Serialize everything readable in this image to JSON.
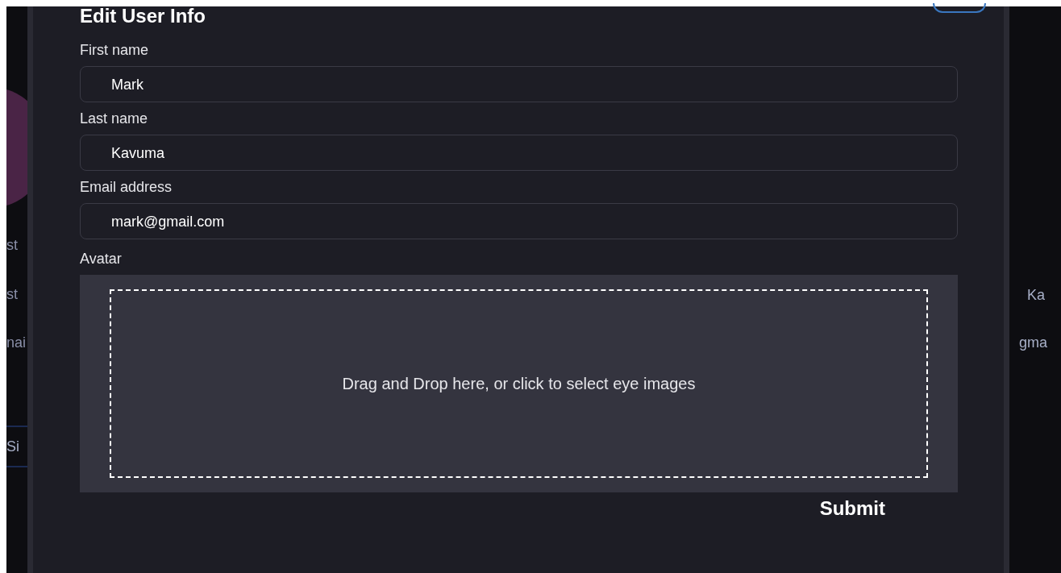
{
  "background": {
    "left_texts": [
      "st",
      "st",
      "nai",
      "Si"
    ],
    "right_texts": [
      "Ka",
      "gma"
    ]
  },
  "dialog": {
    "title": "Edit User Info",
    "fields": [
      {
        "label": "First name",
        "value": "Mark"
      },
      {
        "label": "Last name",
        "value": "Kavuma"
      },
      {
        "label": "Email address",
        "value": "mark@gmail.com"
      }
    ],
    "avatar": {
      "label": "Avatar",
      "dropzone_text": "Drag and Drop here, or click to select eye images"
    },
    "submit": "Submit"
  }
}
